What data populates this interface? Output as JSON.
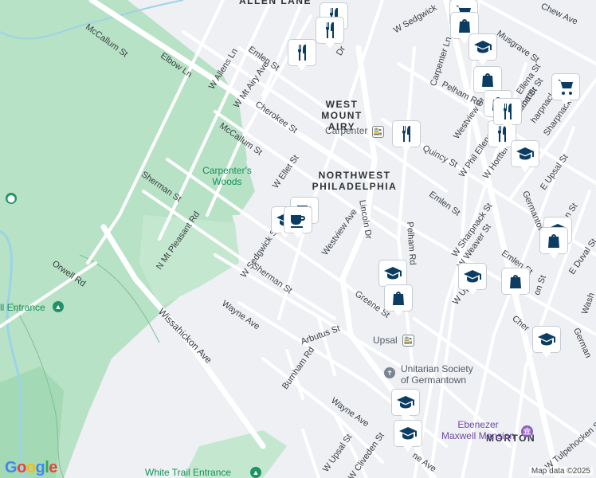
{
  "map": {
    "areas": {
      "west_mount_airy": "WEST\nMOUNT AIRY",
      "northwest_philadelphia": "NORTHWEST\nPHILADELPHIA",
      "morton": "MORTON",
      "allen_lane": "ALLEN LANE"
    },
    "parks": {
      "carpenters_woods": "Carpenter's\nWoods"
    },
    "pois": {
      "carpenter_station": "Carpenter",
      "upsal_station": "Upsal",
      "unitarian": "Unitarian Society\nof Germantown",
      "ebenezer": "Ebenezer\nMaxwell Mansion",
      "trail_entrance": "ll Entrance",
      "white_trail_entrance": "White Trail Entrance"
    },
    "streets": {
      "mccallum_st_top": "McCallum St",
      "elbow_ln": "Elbow Ln",
      "w_allens_ln": "W Allens Ln",
      "emlen_st_top": "Emlen St",
      "w_mt_airy_ave": "W Mt Airy Ave",
      "cherokee_st": "Cherokee St",
      "mccallum_st_mid": "McCallum St",
      "w_ellet_st": "W Ellet St",
      "sherman_st_left": "Sherman St",
      "n_mt_pleasant_rd": "N Mt Pleasant Rd",
      "orwell_rd": "Orwell Rd",
      "w_sedgwick_st_mid": "W Sedgwick St",
      "sherman_st_mid": "Sherman St",
      "wayne_ave_left": "Wayne Ave",
      "wissahickon_ave": "Wissahickon Ave",
      "arbutus_st": "Arbutus St",
      "burnham_rd": "Burnham Rd",
      "westview_ave": "Westview Ave",
      "lincoln_dr": "Lincoln Dr",
      "pelham_rd": "Pelham Rd",
      "greene_st": "Greene St",
      "emlen_st_right": "Emlen St",
      "wayne_ave_bottom": "Wayne Ave",
      "w_upsal_st": "W Upsal St",
      "cliveden_st": "W Cliveden St",
      "ne_ave": "ne Ave",
      "w_sedgwick_st_top": "W Sedgwick",
      "musgrave_st": "Musgrave St",
      "chew_ave": "Chew Ave",
      "carpenter_ln": "Carpenter Ln",
      "pelham_rd_top": "Pelham Rd",
      "ellena_st": "Ellena St",
      "westview_st": "Westview St",
      "quincy_st": "Quincy St",
      "w_phil_ellena_st": "W Phil Ellena St",
      "w_hortter_st": "W Hortter St",
      "germantown_ave": "Germantown",
      "e_upsal_st": "E Upsal St",
      "e_sharpnack_st": "Sharpnack St",
      "w_sharpnack_st": "W Sharpnack St",
      "w_weaver_st": "W Weaver St",
      "emlen_st_lower": "Emlen St",
      "w_up": "W Up",
      "johnson_st": "Johnson St",
      "e_duval_st": "E Duval St",
      "wash": "Wash",
      "on_st": "on St",
      "cher": "Cher",
      "w_tulpehocken_st": "W Tulpehocken St",
      "german": "German",
      "ontana_st": "ontana St",
      "ortter_st": "ortter St",
      "harpnack_st": "harpnack St",
      "top_dr": "Dr"
    },
    "credit": "Map data ©2025",
    "logo": "Google",
    "colors": {
      "background": "#eef0f3",
      "park": "#b7e2c5",
      "park_dark": "#a3d9b4",
      "water": "#9dd3e8",
      "road": "#ffffff",
      "pin_icon": "#0b3d63",
      "park_label": "#178f5a"
    },
    "pin_icons": [
      "restaurant-icon",
      "cafe-icon",
      "school-icon",
      "shopping-bag-icon",
      "shopping-cart-icon"
    ]
  }
}
